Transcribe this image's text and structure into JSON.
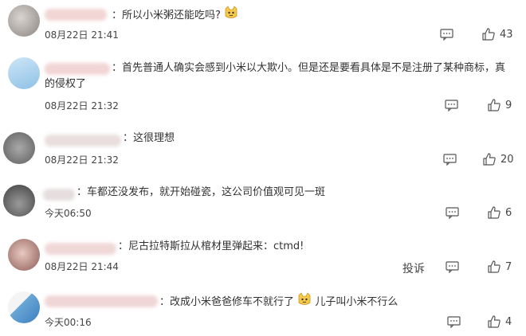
{
  "comments": [
    {
      "text": "所以小米粥还能吃吗?",
      "time": "08月22日 21:41",
      "likes": "43"
    },
    {
      "text": "首先普通人确实会感到小米以大欺小。但是还是要看具体是不是注册了某种商标，真的侵权了",
      "time": "08月22日 21:32",
      "likes": "9"
    },
    {
      "text": "这很理想",
      "time": "08月22日 21:32",
      "likes": "20"
    },
    {
      "text": "车都还没发布，就开始碰瓷，这公司价值观可见一斑",
      "time": "今天06:50",
      "likes": "6"
    },
    {
      "text": "尼古拉特斯拉从棺材里弹起来：ctmd!",
      "time": "08月22日 21:44",
      "likes": "7",
      "report": "投诉"
    },
    {
      "text_a": "改成小米爸爸修车不就行了",
      "text_b": "儿子叫小米不行么",
      "time": "今天00:16",
      "likes": "4"
    }
  ],
  "icons": {
    "comment": "comment-icon",
    "like": "thumbs-up-icon",
    "emoji": "cat-face-emoji"
  }
}
